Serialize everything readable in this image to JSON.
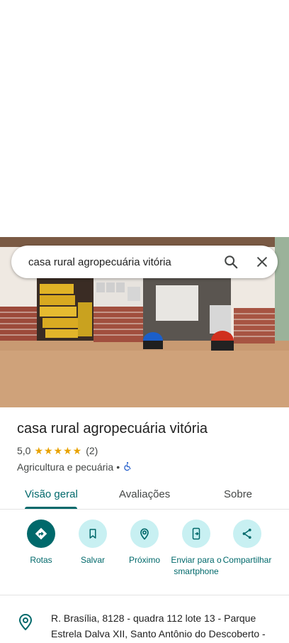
{
  "search": {
    "query": "casa rural agropecuária vitória"
  },
  "place": {
    "name": "casa rural agropecuária vitória",
    "rating": "5,0",
    "stars": "★★★★★",
    "review_count": "(2)",
    "category": "Agricultura e pecuária",
    "separator": "•"
  },
  "tabs": [
    {
      "label": "Visão geral"
    },
    {
      "label": "Avaliações"
    },
    {
      "label": "Sobre"
    }
  ],
  "actions": [
    {
      "label": "Rotas",
      "icon": "directions-icon"
    },
    {
      "label": "Salvar",
      "icon": "bookmark-icon"
    },
    {
      "label": "Próximo",
      "icon": "nearby-icon"
    },
    {
      "label": "Enviar para o smartphone",
      "icon": "send-to-phone-icon"
    },
    {
      "label": "Compartilhar",
      "icon": "share-icon"
    }
  ],
  "address": {
    "text": "R. Brasília, 8128 - quadra 112 lote 13 - Parque Estrela Dalva XII, Santo Antônio do Descoberto -"
  },
  "colors": {
    "accent": "#00696b",
    "chip": "#c8f0f2",
    "star": "#e8a200"
  }
}
